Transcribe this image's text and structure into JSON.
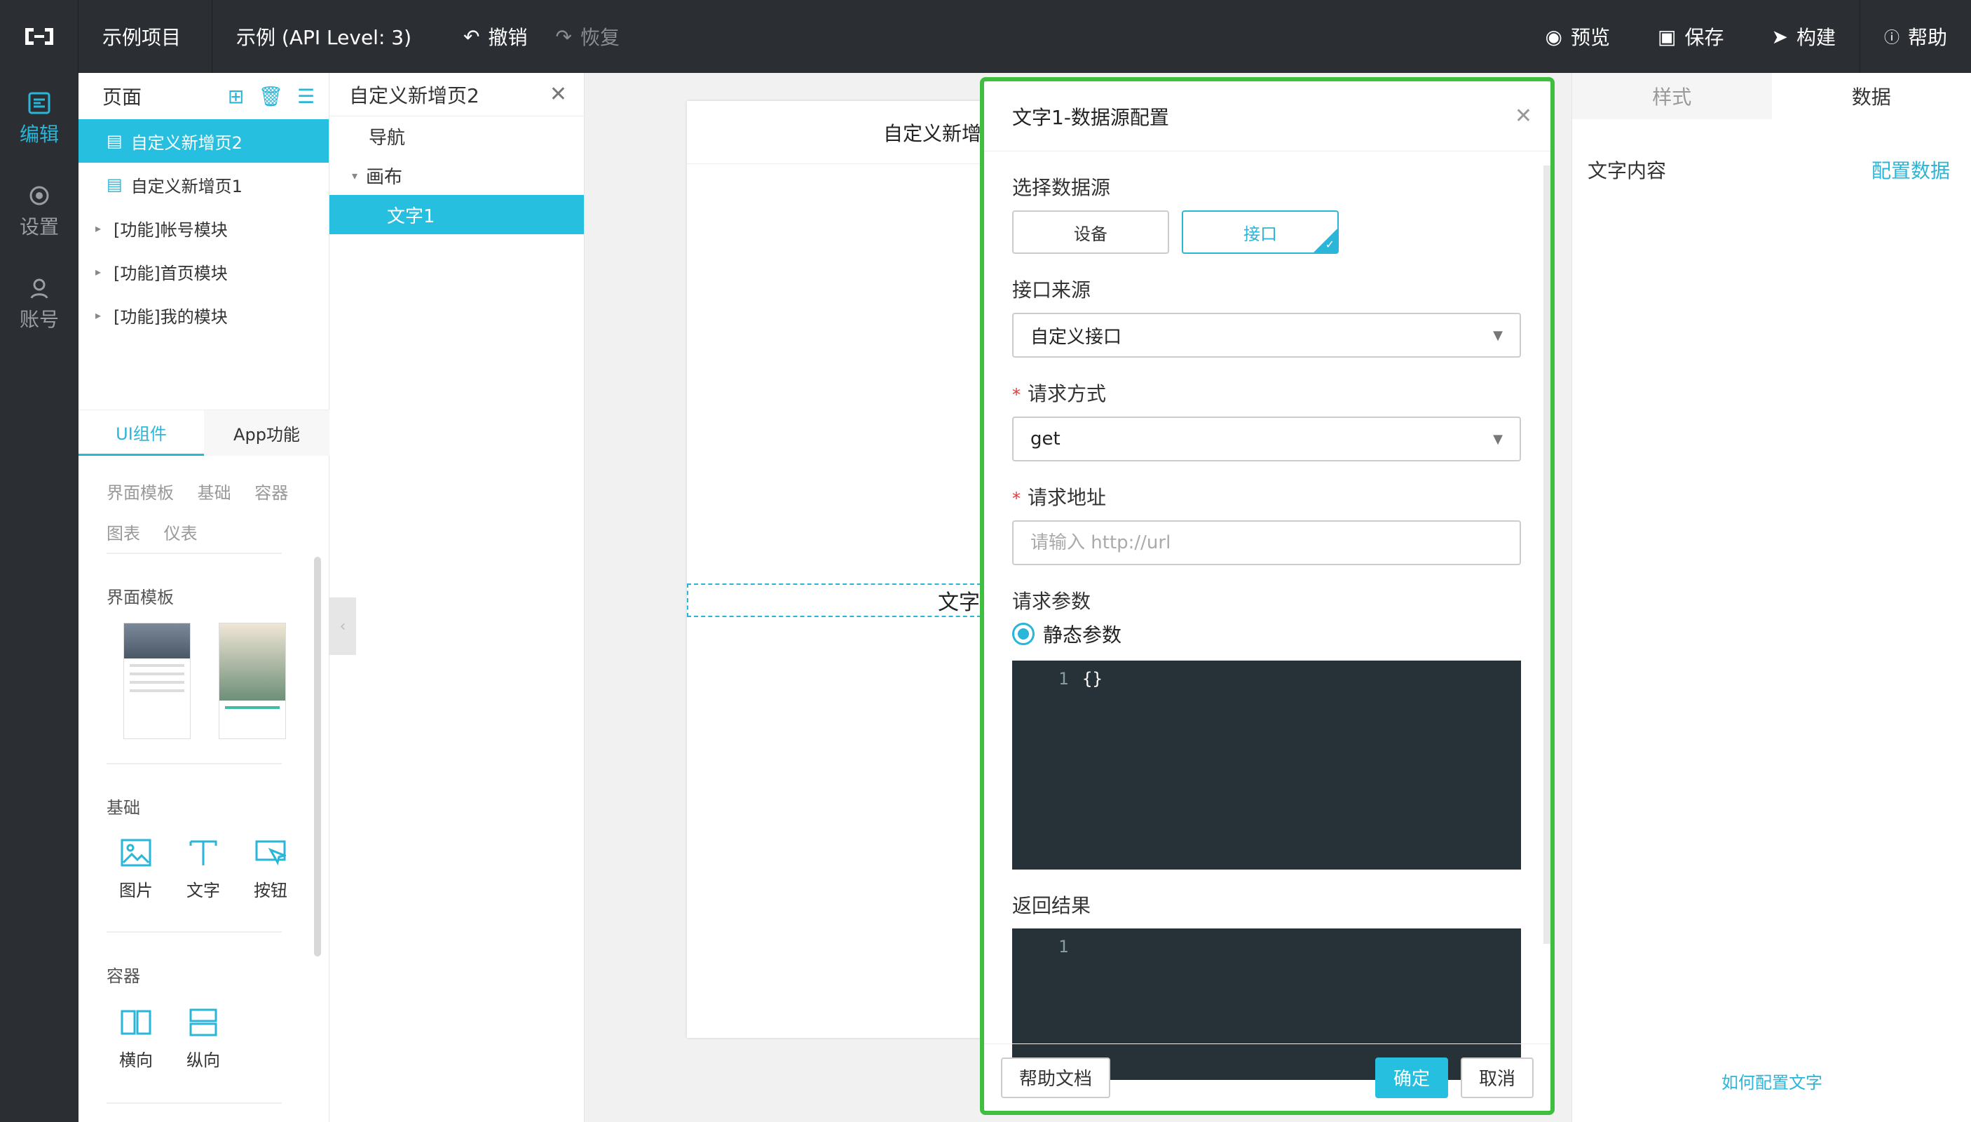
{
  "topbar": {
    "project": "示例项目",
    "app": "示例 (API Level: 3)",
    "undo": "撤销",
    "redo": "恢复",
    "preview": "预览",
    "save": "保存",
    "build": "构建",
    "help": "帮助"
  },
  "leftnav": {
    "items": [
      {
        "label": "编辑",
        "icon": "edit-icon"
      },
      {
        "label": "设置",
        "icon": "settings-icon"
      },
      {
        "label": "账号",
        "icon": "account-icon"
      }
    ]
  },
  "pages": {
    "title": "页面",
    "items": [
      {
        "label": "自定义新增页2"
      },
      {
        "label": "自定义新增页1"
      },
      {
        "label": "[功能]帐号模块"
      },
      {
        "label": "[功能]首页模块"
      },
      {
        "label": "[功能]我的模块"
      }
    ],
    "tabs": [
      "UI组件",
      "App功能"
    ],
    "categories": [
      "界面模板",
      "基础",
      "容器",
      "图表",
      "仪表"
    ],
    "sections": {
      "templates": "界面模板",
      "basic": "基础",
      "container": "容器"
    },
    "basic_items": [
      "图片",
      "文字",
      "按钮"
    ],
    "container_items": [
      "横向",
      "纵向"
    ]
  },
  "tree": {
    "title": "自定义新增页2",
    "items": [
      "导航",
      "画布",
      "文字1"
    ]
  },
  "canvas": {
    "page_title": "自定义新增",
    "text_component": "文字"
  },
  "modal": {
    "title": "文字1-数据源配置",
    "source_label": "选择数据源",
    "source_options": [
      "设备",
      "接口"
    ],
    "api_source_label": "接口来源",
    "api_source_value": "自定义接口",
    "method_label": "请求方式",
    "method_value": "get",
    "url_label": "请求地址",
    "url_placeholder": "请输入 http://url",
    "params_label": "请求参数",
    "params_radio": "静态参数",
    "params_code_line": "1",
    "params_code": "{}",
    "result_label": "返回结果",
    "result_code_line": "1",
    "help_doc": "帮助文档",
    "confirm": "确定",
    "cancel": "取消"
  },
  "props": {
    "tabs": [
      "样式",
      "数据"
    ],
    "row_label": "文字内容",
    "row_link": "配置数据",
    "help_link": "如何配置文字"
  },
  "colors": {
    "accent": "#29b6d8",
    "topbar": "#2b2e33",
    "highlight_border": "#3fbf3f",
    "code_bg": "#263238"
  }
}
